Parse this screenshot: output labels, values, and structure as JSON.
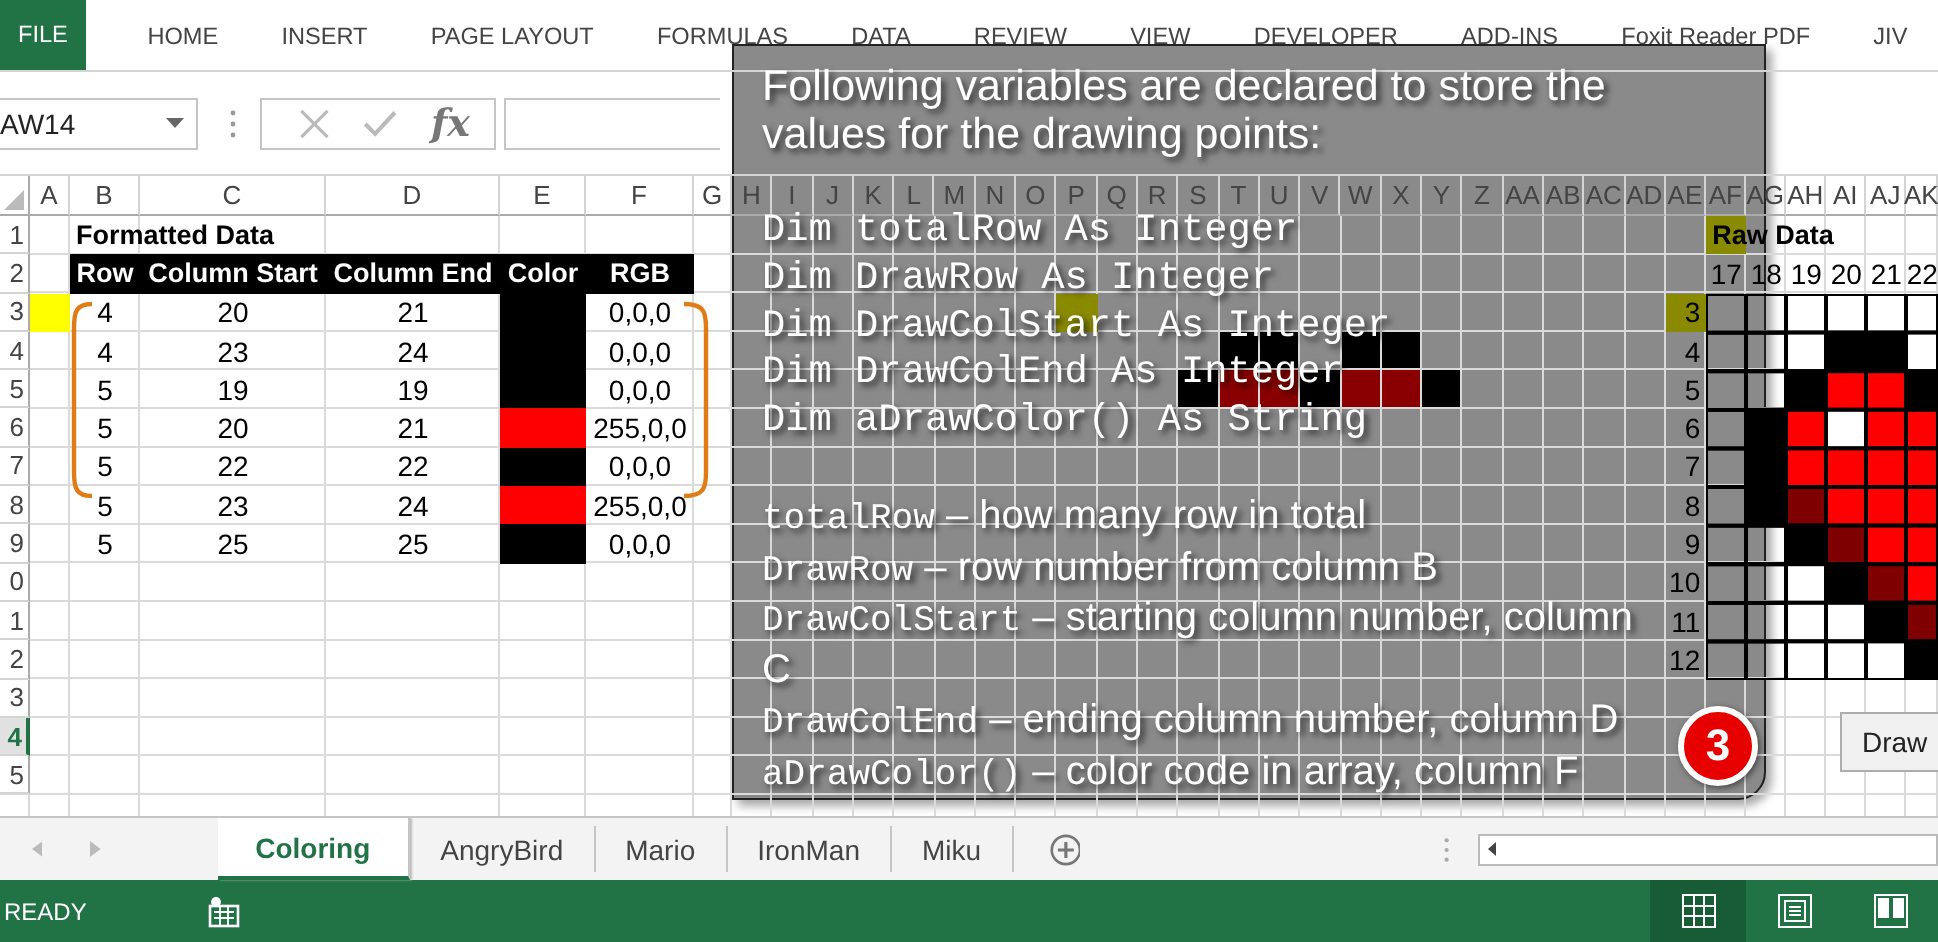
{
  "ribbon": {
    "tabs": [
      {
        "label": "FILE",
        "kind": "file"
      },
      {
        "label": "HOME",
        "kind": "tab"
      },
      {
        "label": "INSERT",
        "kind": "tab"
      },
      {
        "label": "PAGE LAYOUT",
        "kind": "tab"
      },
      {
        "label": "FORMULAS",
        "kind": "tab"
      },
      {
        "label": "DATA",
        "kind": "tab"
      },
      {
        "label": "REVIEW",
        "kind": "tab"
      },
      {
        "label": "VIEW",
        "kind": "tab"
      },
      {
        "label": "DEVELOPER",
        "kind": "tab"
      },
      {
        "label": "ADD-INS",
        "kind": "tab"
      },
      {
        "label": "Foxit Reader PDF",
        "kind": "tab"
      },
      {
        "label": "JIV",
        "kind": "tab"
      }
    ]
  },
  "formula_bar": {
    "name_box": "AW14",
    "function_label": "fx"
  },
  "sheet": {
    "columns": [
      "A",
      "B",
      "C",
      "D",
      "E",
      "F",
      "G",
      "H",
      "I",
      "J",
      "K",
      "L",
      "M",
      "N",
      "O",
      "P",
      "Q",
      "R",
      "S",
      "T",
      "U",
      "V",
      "W",
      "X",
      "Y",
      "Z",
      "AA",
      "AB",
      "AC",
      "AD",
      "AE",
      "AF",
      "AG",
      "AH",
      "AI",
      "AJ",
      "AK"
    ],
    "rows": [
      {
        "label": "1",
        "selected": false,
        "highlighted": false
      },
      {
        "label": "2",
        "selected": false,
        "highlighted": false
      },
      {
        "label": "3",
        "selected": false,
        "highlighted": true
      },
      {
        "label": "4",
        "selected": false,
        "highlighted": false
      },
      {
        "label": "5",
        "selected": false,
        "highlighted": false
      },
      {
        "label": "6",
        "selected": false,
        "highlighted": false
      },
      {
        "label": "7",
        "selected": false,
        "highlighted": false
      },
      {
        "label": "8",
        "selected": false,
        "highlighted": false
      },
      {
        "label": "9",
        "selected": false,
        "highlighted": false
      },
      {
        "label": "0",
        "selected": false,
        "highlighted": false
      },
      {
        "label": "1",
        "selected": false,
        "highlighted": false
      },
      {
        "label": "2",
        "selected": false,
        "highlighted": false
      },
      {
        "label": "3",
        "selected": false,
        "highlighted": false
      },
      {
        "label": "4",
        "selected": true,
        "highlighted": false
      },
      {
        "label": "5",
        "selected": false,
        "highlighted": false
      }
    ],
    "formatted_data": {
      "title": "Formatted Data",
      "columns": [
        "Row",
        "Column Start",
        "Column End",
        "Color",
        "RGB"
      ],
      "rows": [
        {
          "row": "4",
          "column_start": "20",
          "column_end": "21",
          "color": "#000000",
          "rgb": "0,0,0",
          "highlighted": true
        },
        {
          "row": "4",
          "column_start": "23",
          "column_end": "24",
          "color": "#000000",
          "rgb": "0,0,0",
          "highlighted": false
        },
        {
          "row": "5",
          "column_start": "19",
          "column_end": "19",
          "color": "#000000",
          "rgb": "0,0,0",
          "highlighted": false
        },
        {
          "row": "5",
          "column_start": "20",
          "column_end": "21",
          "color": "#ff0000",
          "rgb": "255,0,0",
          "highlighted": false
        },
        {
          "row": "5",
          "column_start": "22",
          "column_end": "22",
          "color": "#000000",
          "rgb": "0,0,0",
          "highlighted": false
        },
        {
          "row": "5",
          "column_start": "23",
          "column_end": "24",
          "color": "#ff0000",
          "rgb": "255,0,0",
          "highlighted": false
        },
        {
          "row": "5",
          "column_start": "25",
          "column_end": "25",
          "color": "#000000",
          "rgb": "0,0,0",
          "highlighted": false
        }
      ]
    },
    "raw_data": {
      "title": "Raw Data",
      "title_highlighted": true,
      "columns": [
        "17",
        "18",
        "19",
        "20",
        "21",
        "22"
      ],
      "rows": [
        {
          "label": "3",
          "highlighted": true
        },
        {
          "label": "4",
          "highlighted": false
        },
        {
          "label": "5",
          "highlighted": false
        },
        {
          "label": "6",
          "highlighted": false
        },
        {
          "label": "7",
          "highlighted": false
        },
        {
          "label": "8",
          "highlighted": false
        },
        {
          "label": "9",
          "highlighted": false
        },
        {
          "label": "10",
          "highlighted": false
        },
        {
          "label": "11",
          "highlighted": false
        },
        {
          "label": "12",
          "highlighted": false
        }
      ]
    },
    "button": "Draw"
  },
  "callout": {
    "heading": "Following variables are declared to store the values for the drawing points:",
    "code": [
      "Dim totalRow As Integer",
      "Dim DrawRow As Integer",
      "Dim DrawColStart As Integer",
      "Dim DrawColEnd As Integer",
      "Dim aDrawColor() As String"
    ],
    "notes": [
      {
        "term": "totalRow",
        "text": "– how many row in total"
      },
      {
        "term": "DrawRow",
        "text": "– row number from column B"
      },
      {
        "term": "DrawColStart",
        "text": "– starting column number, column C"
      },
      {
        "term": "DrawColEnd",
        "text": "– ending column number, column D"
      },
      {
        "term": "aDrawColor()",
        "text": " – color code in array, column F"
      }
    ],
    "badge": "3"
  },
  "sheet_tabs": [
    {
      "label": "Coloring",
      "selected": true
    },
    {
      "label": "AngryBird",
      "selected": false
    },
    {
      "label": "Mario",
      "selected": false
    },
    {
      "label": "IronMan",
      "selected": false
    },
    {
      "label": "Miku",
      "selected": false
    }
  ],
  "status_bar": {
    "text": "READY",
    "views": [
      {
        "kind": "normal",
        "selected": true
      },
      {
        "kind": "page_layout",
        "selected": false
      },
      {
        "kind": "page_break",
        "selected": false
      }
    ]
  }
}
